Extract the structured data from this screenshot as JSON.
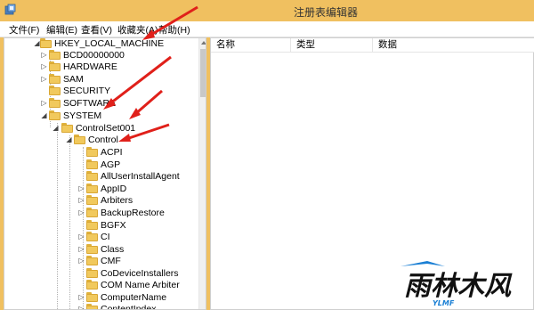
{
  "window": {
    "title": "注册表编辑器"
  },
  "menu": [
    {
      "label": "文件(F)"
    },
    {
      "label": "编辑(E)"
    },
    {
      "label": "查看(V)"
    },
    {
      "label": "收藏夹(A)"
    },
    {
      "label": "帮助(H)"
    }
  ],
  "tree": {
    "root": "HKEY_LOCAL_MACHINE",
    "hives": [
      "BCD00000000",
      "HARDWARE",
      "SAM",
      "SECURITY",
      "SOFTWARE",
      "SYSTEM"
    ],
    "controlset": "ControlSet001",
    "control": "Control",
    "control_children": [
      "ACPI",
      "AGP",
      "AllUserInstallAgent",
      "AppID",
      "Arbiters",
      "BackupRestore",
      "BGFX",
      "CI",
      "Class",
      "CMF",
      "CoDeviceInstallers",
      "COM Name Arbiter",
      "ComputerName",
      "ContentIndex"
    ]
  },
  "list": {
    "columns": [
      "名称",
      "类型",
      "数据"
    ]
  },
  "colors": {
    "titlebar": "#f0c060",
    "arrow": "#e0201a",
    "folder": "#f1c95d"
  },
  "watermark": {
    "text": "雨林木风",
    "sub": "YLMF"
  },
  "icons": {
    "app": "regedit-icon",
    "folder": "folder-icon",
    "expand": "expand-icon",
    "collapse": "collapse-icon"
  }
}
